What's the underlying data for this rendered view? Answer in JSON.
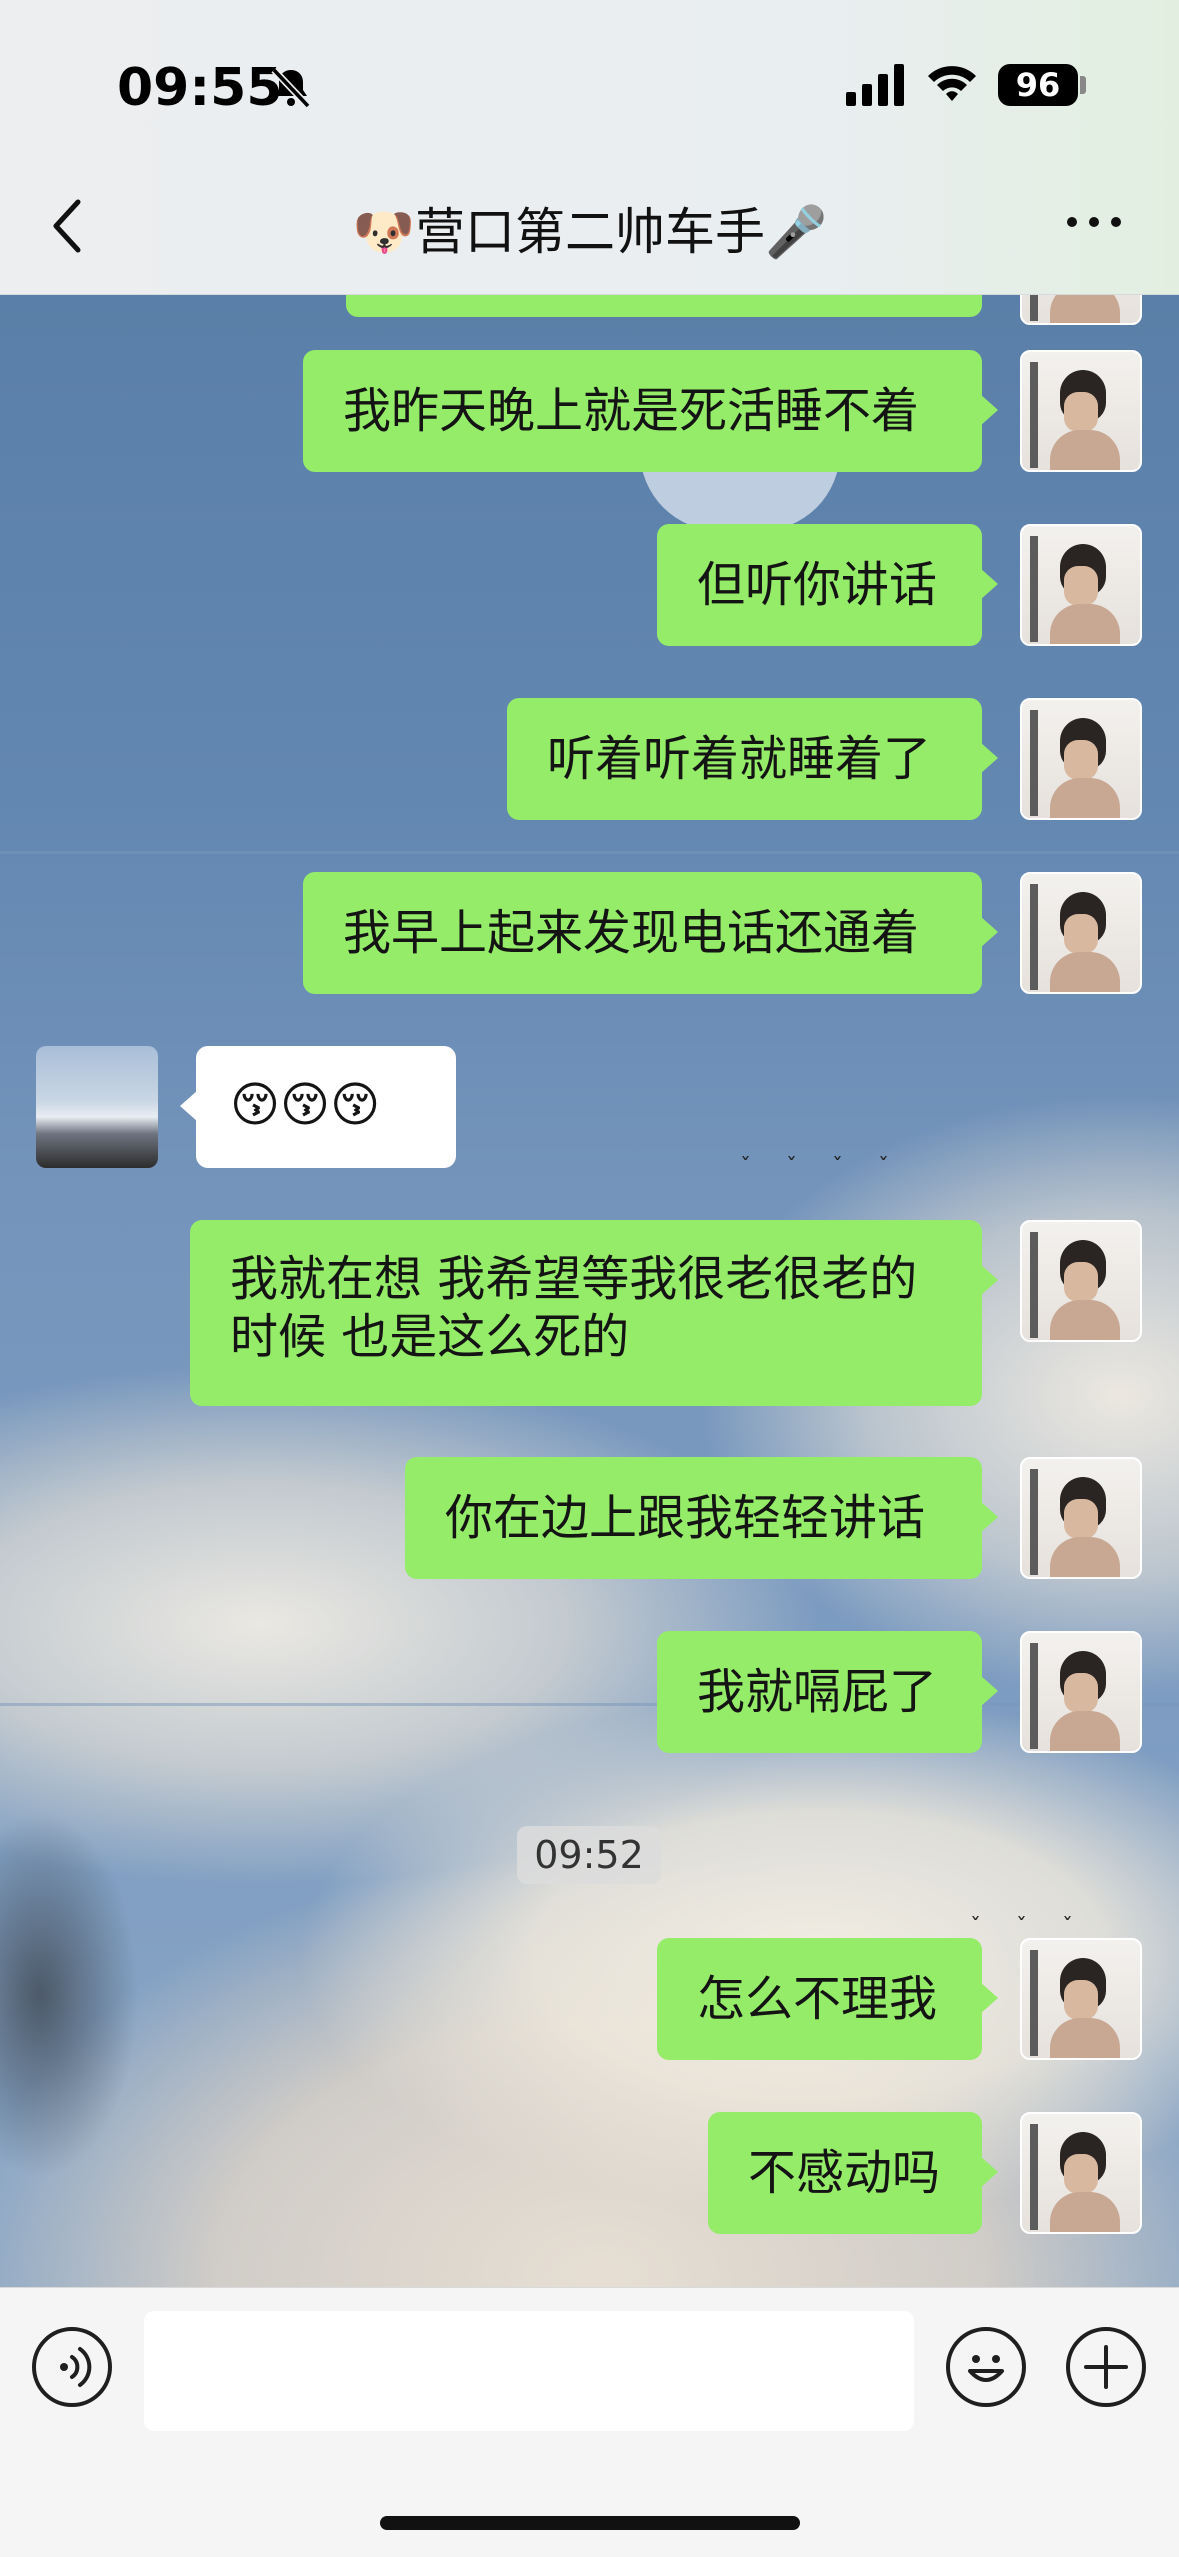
{
  "status_bar": {
    "time": "09:55",
    "battery": "96"
  },
  "nav": {
    "title": "🐶营口第二帅车手🎤"
  },
  "messages": [
    {
      "side": "me",
      "text": "我昨天晚上就是死活睡不着"
    },
    {
      "side": "me",
      "text": "但听你讲话"
    },
    {
      "side": "me",
      "text": "听着听着就睡着了"
    },
    {
      "side": "me",
      "text": "我早上起来发现电话还通着"
    },
    {
      "side": "them",
      "text": "😚😚😚"
    },
    {
      "side": "me",
      "text": "我就在想 我希望等我很老很老的时候 也是这么死的"
    },
    {
      "side": "me",
      "text": "你在边上跟我轻轻讲话"
    },
    {
      "side": "me",
      "text": "我就嗝屁了"
    },
    {
      "side": "me",
      "text": "怎么不理我"
    },
    {
      "side": "me",
      "text": "不感动吗"
    }
  ],
  "timestamp": "09:52",
  "icons": {
    "bell_muted": "bell-slash-icon",
    "signal": "signal-icon",
    "wifi": "wifi-icon",
    "back": "chevron-left-icon",
    "more": "more-dots-icon",
    "voice": "voice-icon",
    "emoji": "emoji-icon",
    "plus": "plus-icon"
  },
  "colors": {
    "my_bubble": "#95ec69",
    "their_bubble": "#ffffff"
  }
}
